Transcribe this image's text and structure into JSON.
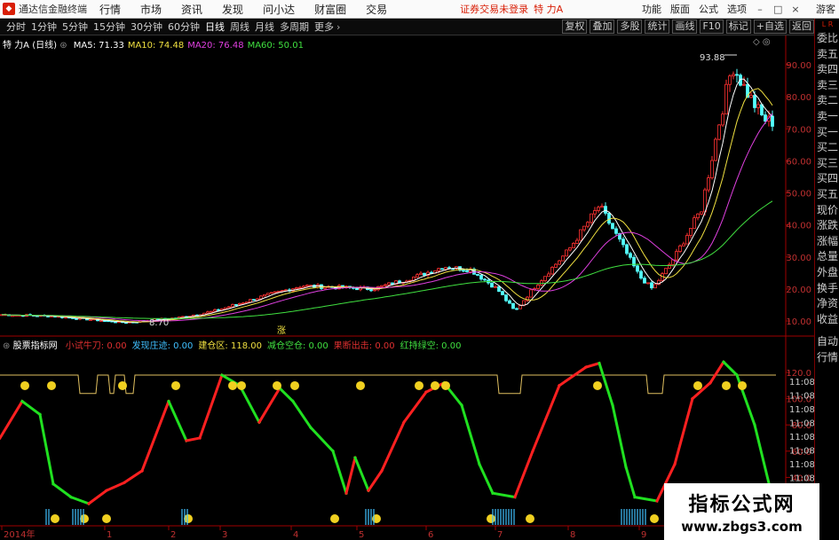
{
  "app": {
    "title": "通达信金融终端",
    "notice": "证券交易未登录",
    "stock": "特 力A"
  },
  "menu": [
    "行情",
    "市场",
    "资讯",
    "发现",
    "问小达",
    "财富圈",
    "交易"
  ],
  "right_menu": [
    "功能",
    "版面",
    "公式",
    "选项"
  ],
  "user": "游客",
  "periods": [
    "分时",
    "1分钟",
    "5分钟",
    "15分钟",
    "30分钟",
    "60分钟",
    "日线",
    "周线",
    "月线",
    "多周期",
    "更多"
  ],
  "active_period": "日线",
  "toolbar_right": [
    "复权",
    "叠加",
    "多股",
    "统计",
    "画线",
    "F10",
    "标记",
    "+自选",
    "返回"
  ],
  "side_tabs": [
    "委比",
    "卖五",
    "卖四",
    "卖三",
    "卖二",
    "卖一",
    "买一",
    "买二",
    "买三",
    "买四",
    "买五",
    "现价",
    "涨跌",
    "涨幅",
    "总量",
    "外盘",
    "换手",
    "净资",
    "收益"
  ],
  "side_tabs2": [
    "自动",
    "行情"
  ],
  "side_lr": {
    "l": "L",
    "r": "R"
  },
  "price_chart": {
    "title": "特 力A",
    "cycle": "(日线)",
    "ma": [
      {
        "label": "MA5: 71.33",
        "color": "#ffffff"
      },
      {
        "label": "MA10: 74.48",
        "color": "#f0e040"
      },
      {
        "label": "MA20: 76.48",
        "color": "#e040e0"
      },
      {
        "label": "MA60: 50.01",
        "color": "#40e040"
      }
    ],
    "y_ticks": [
      "90.00",
      "80.00",
      "70.00",
      "60.00",
      "50.00",
      "40.00",
      "30.00",
      "20.00",
      "10.00"
    ],
    "y_values": [
      90,
      80,
      70,
      60,
      50,
      40,
      30,
      20,
      10
    ],
    "high_label": "93.88",
    "low_label": "8.70",
    "marker": "涨"
  },
  "indicator": {
    "title": "股票指标网",
    "items": [
      {
        "label": "小试牛刀: 0.00",
        "color": "#e03030"
      },
      {
        "label": "发现庄迹: 0.00",
        "color": "#40c0ff"
      },
      {
        "label": "建仓区: 118.00",
        "color": "#f0e040"
      },
      {
        "label": "减仓空仓: 0.00",
        "color": "#40e040"
      },
      {
        "label": "果断出击: 0.00",
        "color": "#e03030"
      },
      {
        "label": "红持绿空: 0.00",
        "color": "#40e040"
      }
    ],
    "y_ticks": [
      "120.0",
      "100.0",
      "80.0",
      "60.0",
      "40.0",
      "20.0"
    ],
    "y_values": [
      120,
      100,
      80,
      60,
      40,
      20
    ],
    "side_times": [
      "11:08",
      "11:08",
      "11:08",
      "11:08",
      "11:08",
      "11:08",
      "11:08",
      "11:08",
      "11:08",
      "11:08"
    ]
  },
  "x_axis": [
    "2014年",
    "1",
    "2",
    "3",
    "4",
    "5",
    "6",
    "7",
    "8",
    "9"
  ],
  "watermark": {
    "text": "指标公式网",
    "url": "www.zbgs3.com"
  }
}
